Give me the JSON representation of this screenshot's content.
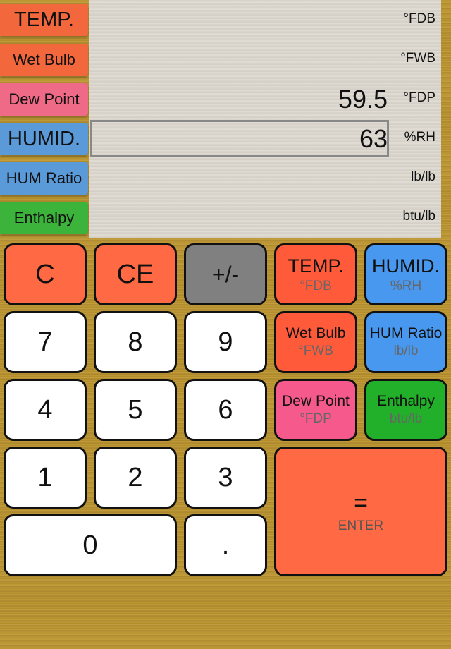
{
  "labels": [
    {
      "text": "TEMP.",
      "color": "#f2683c"
    },
    {
      "text": "Wet Bulb",
      "color": "#f2683c"
    },
    {
      "text": "Dew Point",
      "color": "#ee6a86"
    },
    {
      "text": "HUMID.",
      "color": "#5a9ad8"
    },
    {
      "text": "HUM Ratio",
      "color": "#5a9ad8"
    },
    {
      "text": "Enthalpy",
      "color": "#3cb43c"
    }
  ],
  "display": {
    "rows": [
      {
        "value": "",
        "unit": "°FDB"
      },
      {
        "value": "",
        "unit": "°FWB"
      },
      {
        "value": "59.5",
        "unit": "°FDP"
      },
      {
        "value": "63",
        "unit": "%RH",
        "selected": true
      },
      {
        "value": "",
        "unit": "lb/lb"
      },
      {
        "value": "",
        "unit": "btu/lb"
      }
    ]
  },
  "keys": {
    "clear": "C",
    "clear_entry": "CE",
    "sign": "+/-",
    "digits": [
      "0",
      "1",
      "2",
      "3",
      "4",
      "5",
      "6",
      "7",
      "8",
      "9"
    ],
    "dot": ".",
    "equals": "=",
    "enter": "ENTER",
    "func": [
      {
        "title": "TEMP.",
        "unit": "°FDB"
      },
      {
        "title": "HUMID.",
        "unit": "%RH"
      },
      {
        "title": "Wet Bulb",
        "unit": "°FWB"
      },
      {
        "title": "HUM Ratio",
        "unit": "lb/lb"
      },
      {
        "title": "Dew Point",
        "unit": "°FDP"
      },
      {
        "title": "Enthalpy",
        "unit": "btu/lb"
      }
    ]
  }
}
